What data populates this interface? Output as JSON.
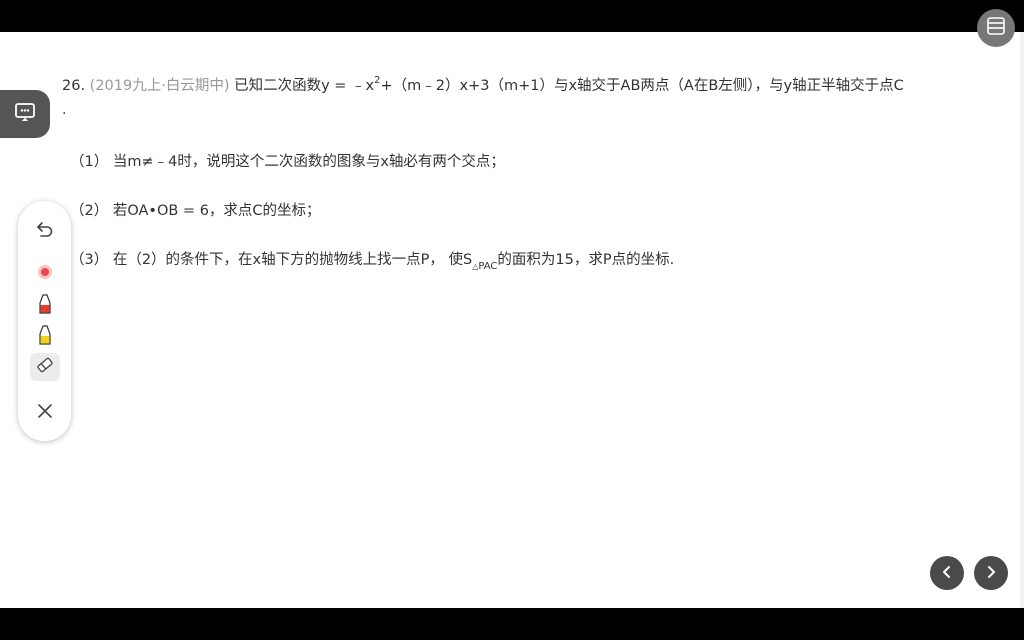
{
  "question": {
    "number": "26.",
    "source": "(2019九上·白云期中)",
    "stem_a": "已知二次函数y = ﹣x",
    "stem_exp": "2",
    "stem_b": "+（m﹣2）x+3（m+1）与x轴交于AB两点（A在B左侧），与y轴正半轴交于点C",
    "stem_end": ".",
    "part1": "（1） 当m≠﹣4时，说明这个二次函数的图象与x轴必有两个交点；",
    "part2": "（2） 若OA•OB = 6，求点C的坐标；",
    "part3_a": "（3） 在（2）的条件下，在x轴下方的抛物线上找一点P， 使S",
    "part3_sub_tri": "△",
    "part3_sub": "PAC",
    "part3_b": "的面积为15，求P点的坐标."
  },
  "toolbar": {
    "tools": [
      "undo-icon",
      "laser-pointer-icon",
      "red-pen-icon",
      "yellow-highlighter-icon",
      "eraser-icon",
      "close-icon"
    ],
    "active_tool": "eraser-icon",
    "colors": {
      "laser": "#e94b4b",
      "red_pen": "#e53b2f",
      "highlighter": "#f2d31c"
    }
  },
  "icons": {
    "cast": "screen-cast-icon",
    "layout": "layout-icon",
    "prev": "chevron-left-icon",
    "next": "chevron-right-icon"
  }
}
